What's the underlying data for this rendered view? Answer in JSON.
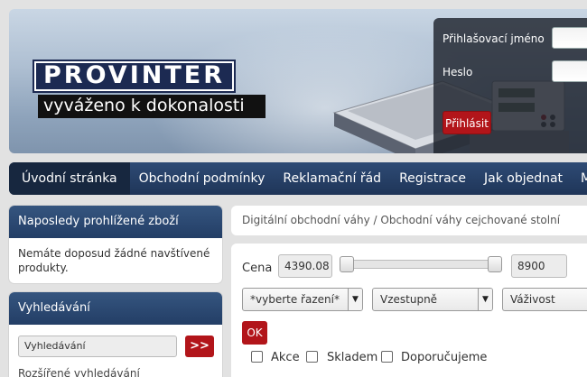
{
  "brand": {
    "logo_text": "PROVINTER",
    "slogan": "vyváženo k dokonalosti"
  },
  "login": {
    "username_label": "Přihlašovací jméno",
    "password_label": "Heslo",
    "submit_label": "Přihlásit"
  },
  "nav": {
    "items": [
      {
        "label": "Úvodní stránka",
        "active": true
      },
      {
        "label": "Obchodní podmínky"
      },
      {
        "label": "Reklamační řád"
      },
      {
        "label": "Registrace"
      },
      {
        "label": "Jak objednat"
      },
      {
        "label": "Moje ob"
      }
    ]
  },
  "sidebar": {
    "recent": {
      "title": "Naposledy prohlížené zboží",
      "text": "Nemáte doposud žádné navštívené produkty."
    },
    "search": {
      "title": "Vyhledávání",
      "input_value": "Vyhledávání",
      "go_label": ">>",
      "advanced_link": "Rozšířené vyhledávání"
    }
  },
  "breadcrumb": {
    "text": "Digitální obchodní váhy / Obchodní váhy cejchované stolní"
  },
  "filter": {
    "price_label": "Cena",
    "price_min": "4390.08",
    "price_max": "8900",
    "sort_select": "*vyberte řazení*",
    "order_select": "Vzestupně",
    "param_select": "Váživost",
    "ok_label": "OK",
    "checkboxes": [
      {
        "label": "Akce",
        "checked": false
      },
      {
        "label": "Skladem",
        "checked": false
      },
      {
        "label": "Doporučujeme",
        "checked": false
      }
    ]
  },
  "colors": {
    "accent_red": "#b2151a",
    "nav_blue": "#233e66",
    "logo_navy": "#1c2a52"
  }
}
